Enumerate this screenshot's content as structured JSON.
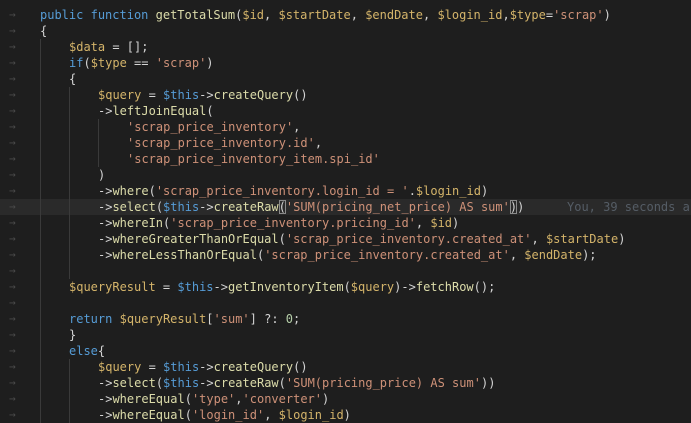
{
  "editor": {
    "gutter_glyph": "→",
    "blame_annotation": "You, 39 seconds a",
    "lines": [
      {
        "indent": 0,
        "tokens": [
          [
            "kw",
            "public"
          ],
          [
            "op",
            " "
          ],
          [
            "kw",
            "function"
          ],
          [
            "op",
            " "
          ],
          [
            "fn",
            "getTotalSum"
          ],
          [
            "op",
            "("
          ],
          [
            "var",
            "$id"
          ],
          [
            "op",
            ", "
          ],
          [
            "var",
            "$startDate"
          ],
          [
            "op",
            ", "
          ],
          [
            "var",
            "$endDate"
          ],
          [
            "op",
            ", "
          ],
          [
            "var",
            "$login_id"
          ],
          [
            "op",
            ","
          ],
          [
            "var",
            "$type"
          ],
          [
            "op",
            "="
          ],
          [
            "str",
            "'scrap'"
          ],
          [
            "op",
            ")"
          ]
        ]
      },
      {
        "indent": 0,
        "tokens": [
          [
            "op",
            "{"
          ]
        ]
      },
      {
        "indent": 1,
        "tokens": [
          [
            "var",
            "$data"
          ],
          [
            "op",
            " = [];"
          ]
        ]
      },
      {
        "indent": 1,
        "tokens": [
          [
            "kw",
            "if"
          ],
          [
            "op",
            "("
          ],
          [
            "var",
            "$type"
          ],
          [
            "op",
            " == "
          ],
          [
            "str",
            "'scrap'"
          ],
          [
            "op",
            ")"
          ]
        ]
      },
      {
        "indent": 1,
        "tokens": [
          [
            "op",
            "{"
          ]
        ]
      },
      {
        "indent": 2,
        "tokens": [
          [
            "var",
            "$query"
          ],
          [
            "op",
            " = "
          ],
          [
            "this",
            "$this"
          ],
          [
            "op",
            "->"
          ],
          [
            "fn",
            "createQuery"
          ],
          [
            "op",
            "()"
          ]
        ]
      },
      {
        "indent": 2,
        "tokens": [
          [
            "op",
            "->"
          ],
          [
            "fn",
            "leftJoinEqual"
          ],
          [
            "op",
            "("
          ]
        ]
      },
      {
        "indent": 3,
        "tokens": [
          [
            "str",
            "'scrap_price_inventory'"
          ],
          [
            "op",
            ","
          ]
        ]
      },
      {
        "indent": 3,
        "tokens": [
          [
            "str",
            "'scrap_price_inventory.id'"
          ],
          [
            "op",
            ","
          ]
        ]
      },
      {
        "indent": 3,
        "tokens": [
          [
            "str",
            "'scrap_price_inventory_item.spi_id'"
          ]
        ]
      },
      {
        "indent": 2,
        "tokens": [
          [
            "op",
            ")"
          ]
        ]
      },
      {
        "indent": 2,
        "tokens": [
          [
            "op",
            "->"
          ],
          [
            "fn",
            "where"
          ],
          [
            "op",
            "("
          ],
          [
            "str",
            "'scrap_price_inventory.login_id = '"
          ],
          [
            "op",
            "."
          ],
          [
            "var",
            "$login_id"
          ],
          [
            "op",
            ")"
          ]
        ]
      },
      {
        "indent": 2,
        "current": true,
        "blame": true,
        "tokens": [
          [
            "op",
            "->"
          ],
          [
            "fn",
            "select"
          ],
          [
            "op",
            "("
          ],
          [
            "this",
            "$this"
          ],
          [
            "op",
            "->"
          ],
          [
            "fn",
            "createRaw"
          ],
          [
            "bm",
            "("
          ],
          [
            "str",
            "'SUM(pricing_net_price) AS sum'"
          ],
          [
            "bm",
            ")"
          ],
          [
            "op",
            ")"
          ]
        ]
      },
      {
        "indent": 2,
        "tokens": [
          [
            "op",
            "->"
          ],
          [
            "fn",
            "whereIn"
          ],
          [
            "op",
            "("
          ],
          [
            "str",
            "'scrap_price_inventory.pricing_id'"
          ],
          [
            "op",
            ", "
          ],
          [
            "var",
            "$id"
          ],
          [
            "op",
            ")"
          ]
        ]
      },
      {
        "indent": 2,
        "tokens": [
          [
            "op",
            "->"
          ],
          [
            "fn",
            "whereGreaterThanOrEqual"
          ],
          [
            "op",
            "("
          ],
          [
            "str",
            "'scrap_price_inventory.created_at'"
          ],
          [
            "op",
            ", "
          ],
          [
            "var",
            "$startDate"
          ],
          [
            "op",
            ")"
          ]
        ]
      },
      {
        "indent": 2,
        "tokens": [
          [
            "op",
            "->"
          ],
          [
            "fn",
            "whereLessThanOrEqual"
          ],
          [
            "op",
            "("
          ],
          [
            "str",
            "'scrap_price_inventory.created_at'"
          ],
          [
            "op",
            ", "
          ],
          [
            "var",
            "$endDate"
          ],
          [
            "op",
            ");"
          ]
        ]
      },
      {
        "indent": 2,
        "tokens": []
      },
      {
        "indent": 1,
        "tokens": [
          [
            "var",
            "$queryResult"
          ],
          [
            "op",
            " = "
          ],
          [
            "this",
            "$this"
          ],
          [
            "op",
            "->"
          ],
          [
            "fn",
            "getInventoryItem"
          ],
          [
            "op",
            "("
          ],
          [
            "var",
            "$query"
          ],
          [
            "op",
            ")->"
          ],
          [
            "fn",
            "fetchRow"
          ],
          [
            "op",
            "();"
          ]
        ]
      },
      {
        "indent": 1,
        "tokens": []
      },
      {
        "indent": 1,
        "tokens": [
          [
            "kw",
            "return"
          ],
          [
            "op",
            " "
          ],
          [
            "var",
            "$queryResult"
          ],
          [
            "op",
            "["
          ],
          [
            "str",
            "'sum'"
          ],
          [
            "op",
            "] ?: "
          ],
          [
            "num",
            "0"
          ],
          [
            "op",
            ";"
          ]
        ]
      },
      {
        "indent": 1,
        "tokens": [
          [
            "op",
            "}"
          ]
        ]
      },
      {
        "indent": 1,
        "tokens": [
          [
            "kw",
            "else"
          ],
          [
            "op",
            "{"
          ]
        ]
      },
      {
        "indent": 2,
        "tokens": [
          [
            "var",
            "$query"
          ],
          [
            "op",
            " = "
          ],
          [
            "this",
            "$this"
          ],
          [
            "op",
            "->"
          ],
          [
            "fn",
            "createQuery"
          ],
          [
            "op",
            "()"
          ]
        ]
      },
      {
        "indent": 2,
        "tokens": [
          [
            "op",
            "->"
          ],
          [
            "fn",
            "select"
          ],
          [
            "op",
            "("
          ],
          [
            "this",
            "$this"
          ],
          [
            "op",
            "->"
          ],
          [
            "fn",
            "createRaw"
          ],
          [
            "op",
            "("
          ],
          [
            "str",
            "'SUM(pricing_price) AS sum'"
          ],
          [
            "op",
            "))"
          ]
        ]
      },
      {
        "indent": 2,
        "tokens": [
          [
            "op",
            "->"
          ],
          [
            "fn",
            "whereEqual"
          ],
          [
            "op",
            "("
          ],
          [
            "str",
            "'type'"
          ],
          [
            "op",
            ","
          ],
          [
            "str",
            "'converter'"
          ],
          [
            "op",
            ")"
          ]
        ]
      },
      {
        "indent": 2,
        "tokens": [
          [
            "op",
            "->"
          ],
          [
            "fn",
            "whereEqual"
          ],
          [
            "op",
            "("
          ],
          [
            "str",
            "'login_id'"
          ],
          [
            "op",
            ", "
          ],
          [
            "var",
            "$login_id"
          ],
          [
            "op",
            ")"
          ]
        ]
      }
    ]
  }
}
